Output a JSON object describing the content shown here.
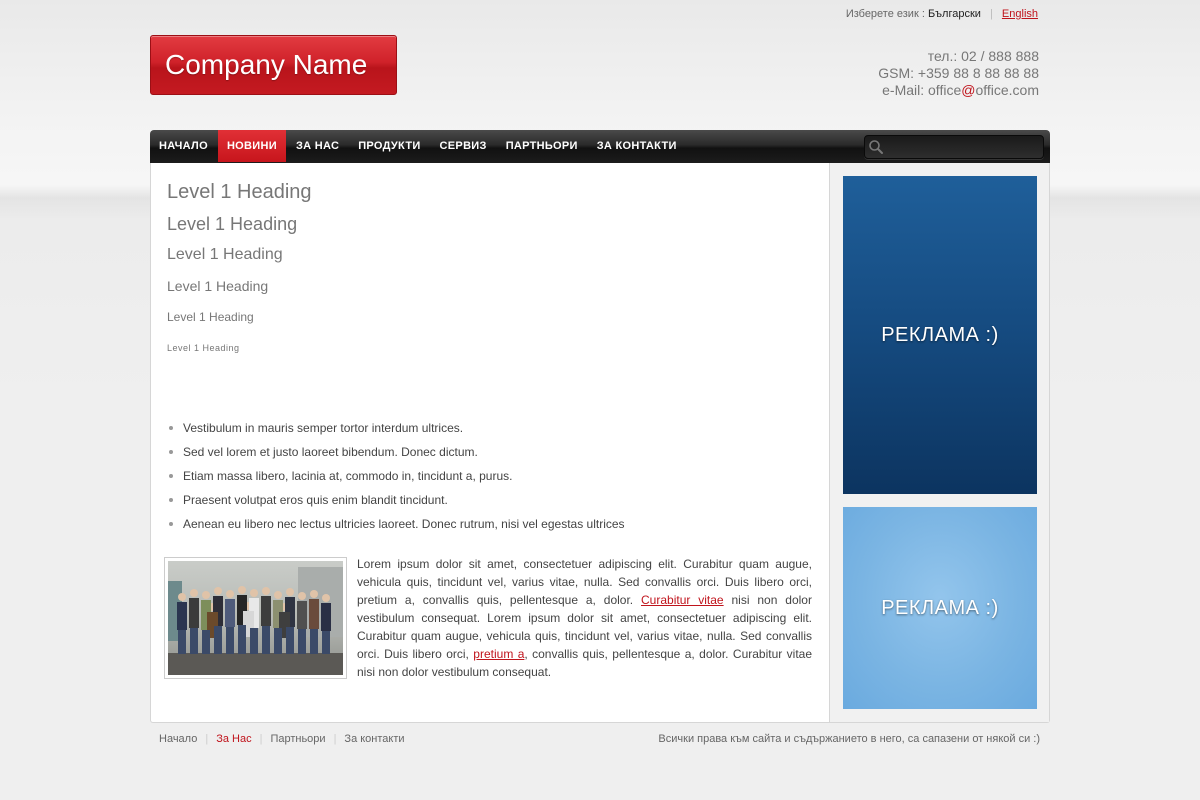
{
  "language": {
    "prompt": "Изберете език :",
    "current": "Български",
    "alternate": "English"
  },
  "logo": {
    "text": "Company Name"
  },
  "contact": {
    "phone": "тел.: 02 / 888 888",
    "gsm": "GSM: +359 88 8 88 88 88",
    "email_prefix": "e-Mail: office",
    "email_at": "@",
    "email_domain": "office.com"
  },
  "nav": {
    "items": [
      "НАЧАЛО",
      "НОВИНИ",
      "ЗА НАС",
      "ПРОДУКТИ",
      "СЕРВИЗ",
      "ПАРТНЬОРИ",
      "ЗА КОНТАКТИ"
    ],
    "active_index": 1,
    "search_placeholder": "",
    "search_icon": "search-icon"
  },
  "headings": [
    "Level 1 Heading",
    "Level 1 Heading",
    "Level 1 Heading",
    "Level 1 Heading",
    "Level 1 Heading",
    "Level 1 Heading"
  ],
  "list": [
    "Vestibulum in mauris semper tortor interdum ultrices.",
    "Sed vel lorem et justo laoreet bibendum. Donec dictum.",
    "Etiam massa libero, lacinia at, commodo in, tincidunt a, purus.",
    "Praesent volutpat eros quis enim blandit tincidunt.",
    "Aenean eu libero nec lectus ultricies laoreet. Donec rutrum, nisi vel egestas ultrices"
  ],
  "paragraph": {
    "part1": "Lorem ipsum dolor sit amet, consectetuer adipiscing elit. Curabitur quam augue, vehicula quis, tincidunt vel, varius vitae, nulla. Sed convallis orci. Duis libero orci, pretium a, convallis quis, pellentesque a, dolor. ",
    "link1": "Curabitur vitae",
    "part2": " nisi non dolor vestibulum consequat. Lorem ipsum dolor sit amet, consectetuer adipiscing elit. Curabitur quam augue, vehicula quis, tincidunt vel, varius vitae, nulla. Sed convallis orci. Duis libero orci, ",
    "link2": "pretium a",
    "part3": ", convallis quis, pellentesque a, dolor. Curabitur vitae nisi non dolor vestibulum consequat."
  },
  "ads": [
    "РЕКЛАМА :)",
    "РЕКЛАМА :)"
  ],
  "colors": {
    "accent": "#c0141c",
    "ad_dark": "#154a7f",
    "ad_light": "#7bb5e3"
  },
  "footer": {
    "links": [
      "Начало",
      "За Нас",
      "Партньори",
      "За контакти"
    ],
    "active_index": 1,
    "copyright": "Всички права към сайта и съдържанието в него, са сапазени от някой си :)"
  }
}
